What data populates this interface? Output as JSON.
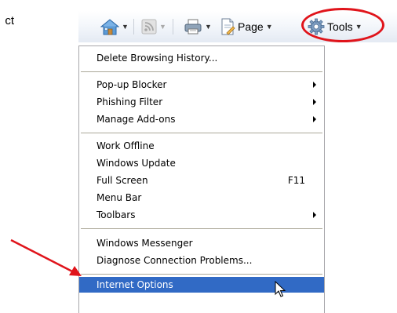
{
  "partial_text": "ct",
  "toolbar": {
    "home_icon": "home-icon",
    "feeds_icon": "rss-feeds-icon",
    "print_icon": "printer-icon",
    "page_icon": "page-icon",
    "page_label": "Page",
    "tools_icon": "gear-icon",
    "tools_label": "Tools"
  },
  "menu": {
    "items": [
      {
        "label": "Delete Browsing History..."
      },
      {
        "label": "Pop-up Blocker",
        "submenu": true
      },
      {
        "label": "Phishing Filter",
        "submenu": true
      },
      {
        "label": "Manage Add-ons",
        "submenu": true
      },
      {
        "label": "Work Offline"
      },
      {
        "label": "Windows Update"
      },
      {
        "label": "Full Screen",
        "shortcut": "F11"
      },
      {
        "label": "Menu Bar"
      },
      {
        "label": "Toolbars",
        "submenu": true
      },
      {
        "label": "Windows Messenger"
      },
      {
        "label": "Diagnose Connection Problems..."
      },
      {
        "label": "Internet Options",
        "selected": true
      }
    ]
  },
  "colors": {
    "annotation_red": "#e0141b",
    "selection_blue": "#316ac5"
  }
}
